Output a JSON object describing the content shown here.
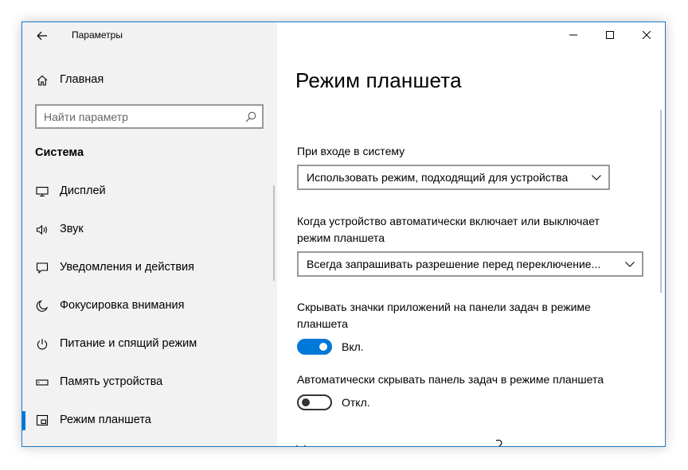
{
  "window": {
    "title": "Параметры",
    "back_icon": "arrow-left-icon",
    "controls": [
      "minimize-icon",
      "maximize-icon",
      "close-icon"
    ]
  },
  "sidebar": {
    "home_label": "Главная",
    "search_placeholder": "Найти параметр",
    "section_title": "Система",
    "items": [
      {
        "label": "Дисплей",
        "icon": "monitor-icon"
      },
      {
        "label": "Звук",
        "icon": "speaker-icon"
      },
      {
        "label": "Уведомления и действия",
        "icon": "notification-icon"
      },
      {
        "label": "Фокусировка внимания",
        "icon": "moon-icon"
      },
      {
        "label": "Питание и спящий режим",
        "icon": "power-icon"
      },
      {
        "label": "Память устройства",
        "icon": "storage-icon"
      },
      {
        "label": "Режим планшета",
        "icon": "tablet-mode-icon",
        "active": true
      }
    ]
  },
  "main": {
    "title": "Режим планшета",
    "signin": {
      "label": "При входе в систему",
      "value": "Использовать режим, подходящий для устройства"
    },
    "auto_switch": {
      "label": "Когда устройство автоматически включает или выключает режим планшета",
      "value": "Всегда запрашивать разрешение перед переключение..."
    },
    "hide_icons": {
      "label": "Скрывать значки приложений на панели задач в режиме планшета",
      "state": "Вкл.",
      "on": true
    },
    "hide_taskbar": {
      "label": "Автоматически скрывать панель задач в режиме планшета",
      "state": "Откл.",
      "on": false
    }
  },
  "colors": {
    "accent": "#0078d7",
    "sidebar_bg": "#f2f2f2",
    "window_border": "#1979ca"
  }
}
